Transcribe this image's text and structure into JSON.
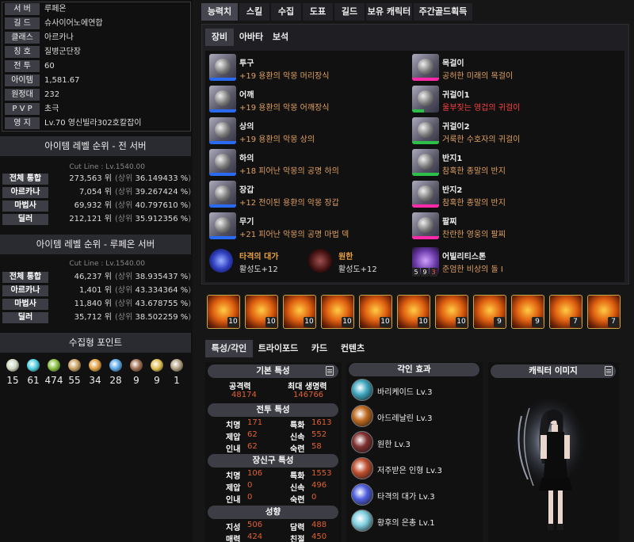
{
  "profile": [
    {
      "label": "서 버",
      "value": "루페온"
    },
    {
      "label": "길 드",
      "value": "슈사이어노에연합"
    },
    {
      "label": "클래스",
      "value": "아르카나"
    },
    {
      "label": "칭 호",
      "value": "질병군단장"
    },
    {
      "label": "전 투",
      "value": "60"
    },
    {
      "label": "아이템",
      "value": "1,581.67"
    },
    {
      "label": "원정대",
      "value": "232"
    },
    {
      "label": "P V P",
      "value": "초극"
    },
    {
      "label": "영 지",
      "value": "Lv.70 영신빌라302호칼잡이"
    }
  ],
  "rank_all": {
    "title": "아이템 레벨 순위 - 전 서버",
    "cut": "Cut Line : Lv.1540.00",
    "rows": [
      {
        "label": "전체 통합",
        "num": "273,563 위",
        "pct_pre": "(상위",
        "pct": "36.149433 %",
        ")": ")"
      },
      {
        "label": "아르카나",
        "num": "7,054 위",
        "pct_pre": "(상위",
        "pct": "39.267424 %"
      },
      {
        "label": "마법사",
        "num": "69,932 위",
        "pct_pre": "(상위",
        "pct": "40.797610 %"
      },
      {
        "label": "딜러",
        "num": "212,121 위",
        "pct_pre": "(상위",
        "pct": "35.912356 %"
      }
    ]
  },
  "rank_server": {
    "title": "아이템 레벨 순위 - 루페온 서버",
    "cut": "Cut Line : Lv.1540.00",
    "rows": [
      {
        "label": "전체 통합",
        "num": "46,237 위",
        "pct_pre": "(상위",
        "pct": "38.935437 %"
      },
      {
        "label": "아르카나",
        "num": "1,401 위",
        "pct_pre": "(상위",
        "pct": "43.334364 %"
      },
      {
        "label": "마법사",
        "num": "11,840 위",
        "pct_pre": "(상위",
        "pct": "43.678755 %"
      },
      {
        "label": "딜러",
        "num": "35,712 위",
        "pct_pre": "(상위",
        "pct": "38.502259 %"
      }
    ]
  },
  "collect": {
    "title": "수집형 포인트",
    "items": [
      {
        "icon": "mokoko-seed-icon",
        "value": "15",
        "color": "#cfd8c0"
      },
      {
        "icon": "island-heart-icon",
        "value": "61",
        "color": "#4fd0e0"
      },
      {
        "icon": "mokoko-icon",
        "value": "474",
        "color": "#8ac040"
      },
      {
        "icon": "art-icon",
        "value": "55",
        "color": "#c9a060"
      },
      {
        "icon": "voyage-icon",
        "value": "34",
        "color": "#e0a040"
      },
      {
        "icon": "star-of-giant-icon",
        "value": "28",
        "color": "#5aa8e8"
      },
      {
        "icon": "ignea-icon",
        "value": "9",
        "color": "#a07050"
      },
      {
        "icon": "orpheus-star-icon",
        "value": "9",
        "color": "#e0c050"
      },
      {
        "icon": "world-tree-leaf-icon",
        "value": "1",
        "color": "#b0a080"
      }
    ]
  },
  "tabs": [
    "능력치",
    "스킬",
    "수집",
    "도표",
    "길드",
    "보유 캐릭터",
    "주간골드획득"
  ],
  "subtabs": [
    "장비",
    "아바타",
    "보석"
  ],
  "equip_left": [
    {
      "name": "투구",
      "desc": "+19 용환의 악몽 머리장식",
      "icon": "helmet-icon"
    },
    {
      "name": "어깨",
      "desc": "+19 용환의 악몽 어깨장식",
      "icon": "shoulder-icon"
    },
    {
      "name": "상의",
      "desc": "+19 용환의 악몽 상의",
      "icon": "top-armor-icon"
    },
    {
      "name": "하의",
      "desc": "+18 피어난 악몽의 공명 하의",
      "icon": "bottom-armor-icon"
    },
    {
      "name": "장갑",
      "desc": "+12 전이된 용환의 악몽 장갑",
      "icon": "gloves-icon"
    },
    {
      "name": "무기",
      "desc": "+21 피어난 악몽의 공명 마법 덱",
      "icon": "weapon-deck-icon"
    }
  ],
  "equip_right": [
    {
      "name": "목걸이",
      "desc": "공허한 미래의 목걸이",
      "icon": "necklace-icon",
      "red": false
    },
    {
      "name": "귀걸이1",
      "desc": "울부짖는 영겁의 귀걸이",
      "icon": "earring-icon",
      "red": true
    },
    {
      "name": "귀걸이2",
      "desc": "거룩한 수호자의 귀걸이",
      "icon": "earring-icon",
      "red": false
    },
    {
      "name": "반지1",
      "desc": "참혹한 종말의 반지",
      "icon": "ring-icon",
      "red": false
    },
    {
      "name": "반지2",
      "desc": "참혹한 종말의 반지",
      "icon": "ring-icon",
      "red": false
    },
    {
      "name": "팔찌",
      "desc": "찬란한 영웅의 팔찌",
      "icon": "bracelet-icon",
      "red": false
    }
  ],
  "sets": [
    {
      "name": "타격의 대가",
      "sub": "활성도+12",
      "icon": "strike-master-icon"
    },
    {
      "name": "원한",
      "sub": "활성도+12",
      "icon": "grudge-icon"
    }
  ],
  "stone": {
    "name": "어빌리티스톤",
    "desc": "준엄한 비상의 돌 I",
    "nums": [
      "5",
      "9",
      "3"
    ],
    "icon": "ability-stone-icon"
  },
  "gems": [
    "10",
    "10",
    "10",
    "10",
    "10",
    "10",
    "10",
    "9",
    "9",
    "7",
    "7"
  ],
  "tabs2": [
    "특성/각인",
    "트라이포드",
    "카드",
    "컨텐츠"
  ],
  "stats": {
    "basic_title": "기본 특성",
    "atk_label": "공격력",
    "atk": "48174",
    "hp_label": "최대 생명력",
    "hp": "146766",
    "combat_title": "전투 특성",
    "combat": [
      [
        "치명",
        "171",
        "특화",
        "1613"
      ],
      [
        "제압",
        "62",
        "신속",
        "552"
      ],
      [
        "인내",
        "62",
        "숙련",
        "58"
      ]
    ],
    "acc_title": "장신구 특성",
    "acc": [
      [
        "치명",
        "106",
        "특화",
        "1553"
      ],
      [
        "제압",
        "0",
        "신속",
        "496"
      ],
      [
        "인내",
        "0",
        "숙련",
        "0"
      ]
    ],
    "tend_title": "성향",
    "tend": [
      [
        "지성",
        "506",
        "담력",
        "488"
      ],
      [
        "매력",
        "424",
        "친절",
        "450"
      ]
    ]
  },
  "engravings": {
    "title": "각인 효과",
    "items": [
      {
        "name": "바리케이드 Lv.3",
        "icon": "barricade-icon",
        "color": "#3fa8c0"
      },
      {
        "name": "아드레날린 Lv.3",
        "icon": "adrenaline-icon",
        "color": "#c06a20"
      },
      {
        "name": "원한 Lv.3",
        "icon": "grudge-icon",
        "color": "#803030"
      },
      {
        "name": "저주받은 인형 Lv.3",
        "icon": "cursed-doll-icon",
        "color": "#c05030"
      },
      {
        "name": "타격의 대가 Lv.3",
        "icon": "strike-master-icon",
        "color": "#5060e0"
      },
      {
        "name": "황후의 은총 Lv.1",
        "icon": "empress-grace-icon",
        "color": "#80d0e0"
      }
    ]
  },
  "char_image_title": "캐릭터 이미지",
  "colors": {
    "accent_pink": "#ff2aa8",
    "desc_orange": "#e0a060",
    "red_text": "#ff4040",
    "stat_value": "#e06030"
  }
}
